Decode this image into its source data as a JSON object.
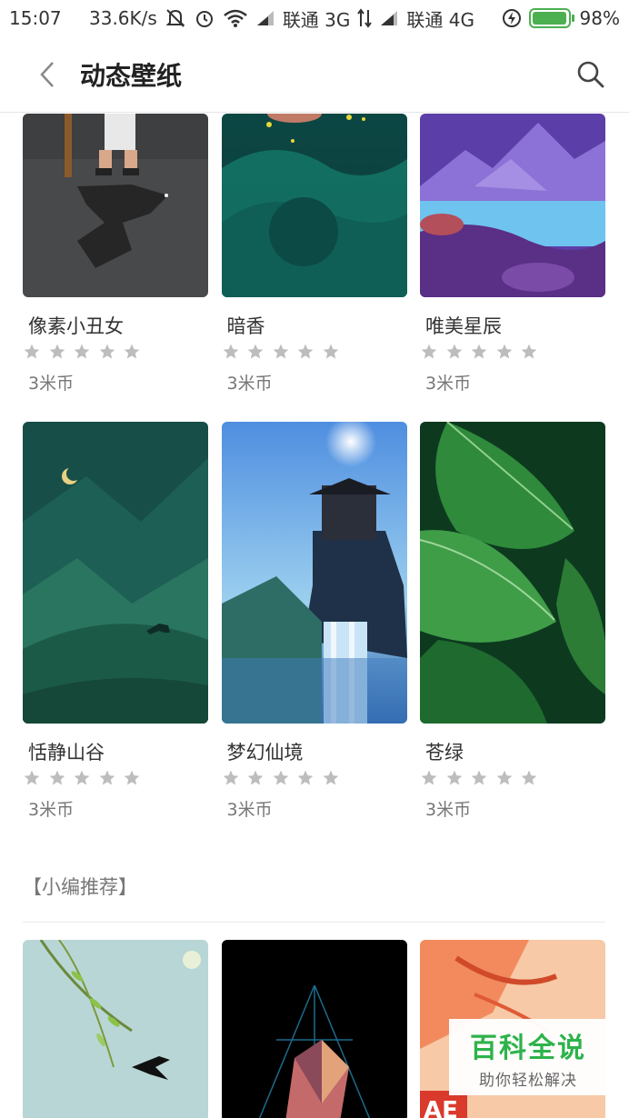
{
  "status_bar": {
    "time": "15:07",
    "net_speed": "33.6K/s",
    "carrier1": "联通 3G",
    "carrier2": "联通 4G",
    "battery": "98%",
    "battery_level": 0.98,
    "icons": [
      "mute-icon",
      "alarm-icon",
      "wifi-icon",
      "signal-icon",
      "data-arrows-icon",
      "signal-icon",
      "charging-icon",
      "battery-icon"
    ]
  },
  "header": {
    "title": "动态壁纸",
    "back_icon": "back-chevron-icon",
    "search_icon": "search-icon"
  },
  "wallpapers_row1": [
    {
      "title": "像素小丑女",
      "price": "3米币",
      "rating": 0
    },
    {
      "title": "暗香",
      "price": "3米币",
      "rating": 0
    },
    {
      "title": "唯美星辰",
      "price": "3米币",
      "rating": 0
    }
  ],
  "wallpapers_row2": [
    {
      "title": "恬静山谷",
      "price": "3米币",
      "rating": 0
    },
    {
      "title": "梦幻仙境",
      "price": "3米币",
      "rating": 0
    },
    {
      "title": "苍绿",
      "price": "3米币",
      "rating": 0
    }
  ],
  "section": {
    "label": "【小编推荐】"
  },
  "recommended_row": [
    {
      "thumb": "willow-swallow"
    },
    {
      "thumb": "geometric-prism"
    },
    {
      "thumb": "ae-illustration",
      "badge": "AE"
    }
  ],
  "watermark": {
    "main": "百科全说",
    "sub": "助你轻松解决"
  },
  "colors": {
    "accent_green": "#2db34a",
    "battery_green": "#4caf50",
    "star_gray": "#bdbdbd"
  }
}
